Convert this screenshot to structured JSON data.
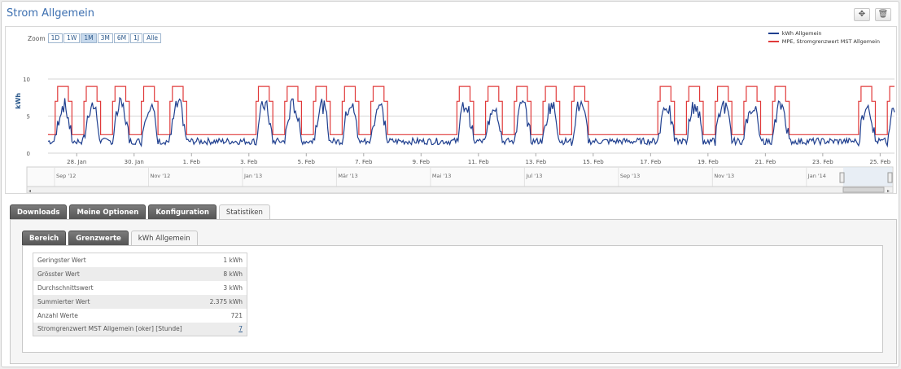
{
  "panel": {
    "title": "Strom Allgemein",
    "move_icon": "move-icon",
    "delete_icon": "trash-icon"
  },
  "zoom": {
    "label": "Zoom",
    "buttons": [
      "1D",
      "1W",
      "1M",
      "3M",
      "6M",
      "1J",
      "Alle"
    ],
    "active": "1M"
  },
  "chart_data": {
    "type": "line",
    "ylabel": "kWh",
    "ylim": [
      0,
      10
    ],
    "yticks": [
      0,
      5,
      10
    ],
    "xticks": [
      "28. Jan",
      "30. Jan",
      "1. Feb",
      "3. Feb",
      "5. Feb",
      "7. Feb",
      "9. Feb",
      "11. Feb",
      "13. Feb",
      "15. Feb",
      "17. Feb",
      "19. Feb",
      "21. Feb",
      "23. Feb",
      "25. Feb"
    ],
    "x_range": [
      "2014-01-27",
      "2014-02-25"
    ],
    "pattern": "Weekdays: consumption rises from ~2 kWh to peaks of ~5-8 kWh during working hours; weekends stay ~1.5-2 kWh. Limit line steps 2 → 7 → 9 on weekdays.",
    "weekday_dates": [
      "2014-01-27",
      "2014-01-28",
      "2014-01-29",
      "2014-01-30",
      "2014-01-31",
      "2014-02-03",
      "2014-02-04",
      "2014-02-05",
      "2014-02-06",
      "2014-02-07",
      "2014-02-10",
      "2014-02-11",
      "2014-02-12",
      "2014-02-13",
      "2014-02-14",
      "2014-02-17",
      "2014-02-18",
      "2014-02-19",
      "2014-02-20",
      "2014-02-21",
      "2014-02-24",
      "2014-02-25"
    ],
    "series": [
      {
        "name": "kWh Allgemein",
        "color": "#1f3f8f",
        "baseline_kwh": 1.6,
        "weekday_peak_kwh": 6.5,
        "max_kwh": 8,
        "min_kwh": 1
      },
      {
        "name": "MPE, Stromgrenzwert MST Allgemein",
        "color": "#e03a3a",
        "night_kwh": 2.5,
        "mid_kwh": 7,
        "peak_kwh": 9
      }
    ],
    "navigator_ticks": [
      "Sep '12",
      "Nov '12",
      "Jan '13",
      "Mär '13",
      "Mai '13",
      "Jul '13",
      "Sep '13",
      "Nov '13",
      "Jan '14"
    ]
  },
  "tabs_main": [
    "Downloads",
    "Meine Optionen",
    "Konfiguration",
    "Statistiken"
  ],
  "tabs_main_active": "Statistiken",
  "tabs_sub": [
    "Bereich",
    "Grenzwerte",
    "kWh Allgemein"
  ],
  "tabs_sub_active": "kWh Allgemein",
  "stats": [
    {
      "label": "Geringster Wert",
      "value": "1 kWh"
    },
    {
      "label": "Grösster Wert",
      "value": "8 kWh"
    },
    {
      "label": "Durchschnittswert",
      "value": "3 kWh"
    },
    {
      "label": "Summierter Wert",
      "value": "2.375 kWh"
    },
    {
      "label": "Anzahl Werte",
      "value": "721"
    },
    {
      "label": "Stromgrenzwert MST Allgemein [oker] [Stunde]",
      "value": "7"
    }
  ]
}
